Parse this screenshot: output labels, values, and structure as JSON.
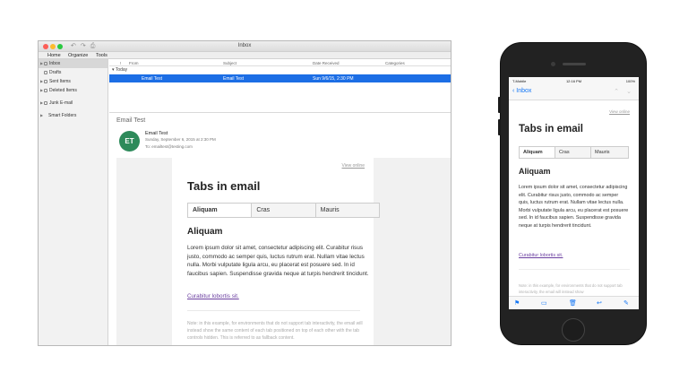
{
  "mac": {
    "window_title": "Inbox",
    "ribbon": [
      "Home",
      "Organize",
      "Tools"
    ],
    "sidebar": [
      {
        "label": "Inbox",
        "active": true
      },
      {
        "label": "Drafts"
      },
      {
        "label": "Sent Items"
      },
      {
        "label": "Deleted Items"
      },
      {
        "label": "Junk E-mail"
      },
      {
        "label": "Smart Folders"
      }
    ],
    "list": {
      "columns": {
        "from": "From",
        "subject": "Subject",
        "date": "Date Received",
        "categories": "Categories"
      },
      "group": "Today",
      "row": {
        "from": "Email Test",
        "subject": "Email Test",
        "date": "Sun 9/6/15, 2:30 PM"
      }
    },
    "reading": {
      "subject": "Email Test",
      "avatar": "ET",
      "from": "Email Test",
      "date": "Sunday, September 6, 2015 at 2:30 PM",
      "to": "To:  emailtest@testing.com"
    }
  },
  "email": {
    "view_online": "View online",
    "title": "Tabs in email",
    "tabs": [
      "Aliquam",
      "Cras",
      "Mauris"
    ],
    "section_heading": "Aliquam",
    "body": "Lorem ipsum dolor sit amet, consectetur adipiscing elit. Curabitur risus justo, commodo ac semper quis, luctus rutrum erat. Nullam vitae lectus nulla. Morbi vulputate ligula arcu, eu placerat est posuere sed. In id faucibus sapien. Suspendisse gravida neque at turpis hendrerit tincidunt.",
    "link": "Curabitur lobortis sit.",
    "note": "Note: in this example, for environments that do not support tab interactivity, the email will instead show the same content of each tab positioned on top of each other with the tab controls hidden. This is referred to as fallback content.",
    "phone_note": "Note: in this example, for environments that do not support tab interactivity, the email will instead show"
  },
  "phone": {
    "carrier": "T-Mobile",
    "time": "12:16 PM",
    "battery": "100%",
    "back": "Inbox"
  }
}
